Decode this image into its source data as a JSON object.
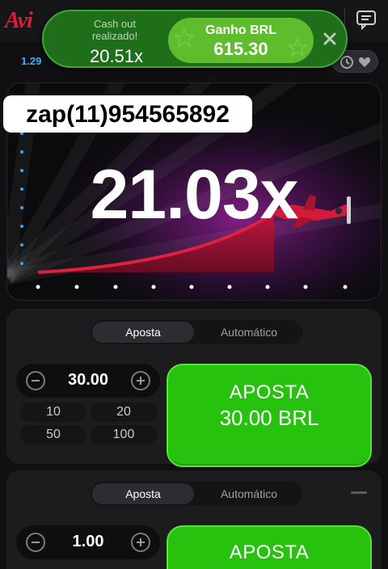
{
  "app": {
    "logo_text": "Avi"
  },
  "history": {
    "first_multiplier": "1.29"
  },
  "toast": {
    "label": "Cash out realizado!",
    "multiplier": "20.51x",
    "win_label": "Ganho BRL",
    "win_amount": "615.30"
  },
  "game": {
    "contact_overlay": "zap(11)954565892",
    "current_multiplier": "21.03x"
  },
  "bet_panels": [
    {
      "tabs": [
        "Aposta",
        "Automático"
      ],
      "active_tab": "Aposta",
      "stake": "30.00",
      "quick_amounts": [
        "10",
        "20",
        "50",
        "100"
      ],
      "button_label": "APOSTA",
      "button_amount": "30.00 BRL"
    },
    {
      "tabs": [
        "Aposta",
        "Automático"
      ],
      "active_tab": "Aposta",
      "stake": "1.00",
      "button_label": "APOSTA"
    }
  ],
  "colors": {
    "brand_red": "#e01a3b",
    "bet_green": "#27c20e",
    "toast_green": "#1f6e1a",
    "multiplier_blue": "#34b4ff",
    "curve_red": "#d41a3a"
  },
  "icons": {
    "chat": "chat-icon",
    "history": "clock-icon",
    "favorite": "heart-icon",
    "close": "close-icon",
    "minus": "minus-icon",
    "plus": "plus-icon",
    "plane": "plane-icon"
  }
}
